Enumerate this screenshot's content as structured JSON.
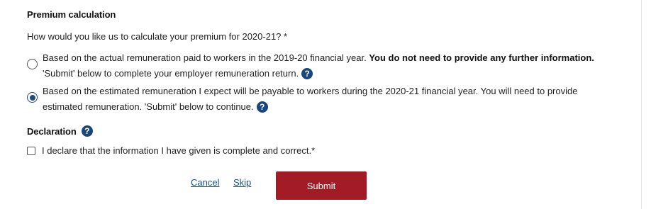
{
  "premium": {
    "title": "Premium calculation",
    "question": "How would you like us to calculate your premium for 2020-21? *",
    "options": [
      {
        "text_before": "Based on the actual remuneration paid to workers in the 2019-20 financial year. ",
        "text_bold": "You do not need to provide any further information.",
        "text_after": " 'Submit' below to complete your employer remuneration return.",
        "selected": false,
        "help_icon": "question-mark"
      },
      {
        "text_before": "Based on the estimated remuneration I expect will be payable to workers during the 2020-21 financial year. You will need to provide estimated remuneration. 'Submit' below to continue.",
        "selected": true,
        "help_icon": "question-mark"
      }
    ]
  },
  "declaration": {
    "title": "Declaration",
    "help_icon": "question-mark",
    "checkbox_label": "I declare that the information I have given is complete and correct.*",
    "checked": false
  },
  "actions": {
    "cancel_label": "Cancel",
    "skip_label": "Skip",
    "submit_label": "Submit"
  },
  "icons": {
    "help_glyph": "?"
  },
  "colors": {
    "submit_bg": "#a21b25",
    "help_icon_bg": "#17477c",
    "link": "#1b4f8a",
    "radio_selected": "#1f4a7d"
  }
}
